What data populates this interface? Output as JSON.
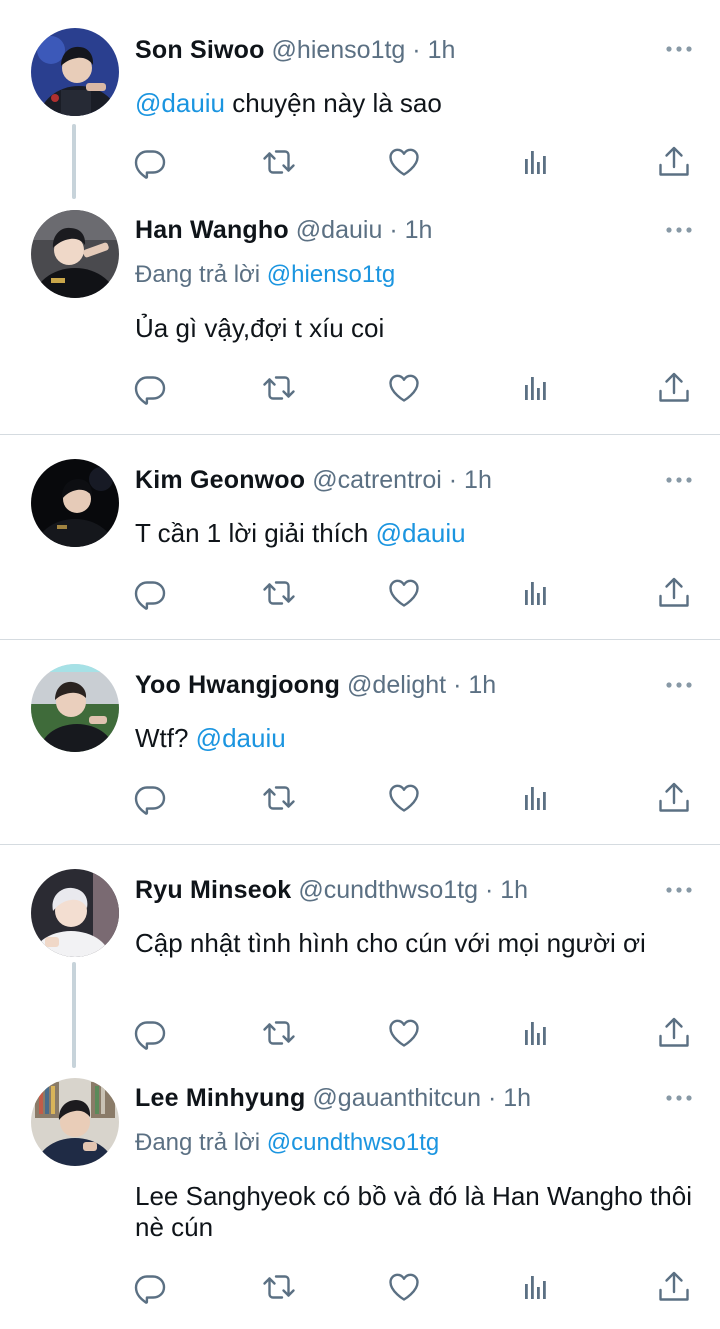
{
  "tweets": [
    {
      "name": "Son Siwoo",
      "handle": "@hienso1tg",
      "dot": "·",
      "time": "1h",
      "reply_prefix": "",
      "reply_to": "",
      "text_before": "",
      "mention": "@dauiu",
      "text_after": " chuyện này là sao"
    },
    {
      "name": "Han Wangho",
      "handle": "@dauiu",
      "dot": "·",
      "time": "1h",
      "reply_prefix": "Đang trả lời ",
      "reply_to": "@hienso1tg",
      "text_before": "Ủa gì vậy,đợi t xíu coi",
      "mention": "",
      "text_after": ""
    },
    {
      "name": "Kim Geonwoo",
      "handle": "@catrentroi",
      "dot": "·",
      "time": "1h",
      "reply_prefix": "",
      "reply_to": "",
      "text_before": "T cần 1 lời giải thích ",
      "mention": "@dauiu",
      "text_after": ""
    },
    {
      "name": "Yoo Hwangjoong",
      "handle": "@delight",
      "dot": "·",
      "time": "1h",
      "reply_prefix": "",
      "reply_to": "",
      "text_before": "Wtf? ",
      "mention": "@dauiu",
      "text_after": ""
    },
    {
      "name": "Ryu Minseok",
      "handle": "@cundthwso1tg",
      "dot": "·",
      "time": "1h",
      "reply_prefix": "",
      "reply_to": "",
      "text_before": "Cập nhật tình hình cho cún với mọi người ơi",
      "mention": "",
      "text_after": ""
    },
    {
      "name": "Lee Minhyung",
      "handle": "@gauanthitcun",
      "dot": "·",
      "time": "1h",
      "reply_prefix": "Đang trả lời ",
      "reply_to": "@cundthwso1tg",
      "text_before": "Lee Sanghyeok có bồ và đó là Han Wangho thôi nè cún",
      "mention": "",
      "text_after": ""
    }
  ],
  "icons": {
    "reply": "reply-icon",
    "retweet": "retweet-icon",
    "like": "heart-icon",
    "stats": "analytics-icon",
    "share": "share-icon",
    "more": "more-icon"
  },
  "colors": {
    "text": "#0f1419",
    "secondary": "#5b7083",
    "mention": "#1b95e0",
    "thread_line": "#c7d3da",
    "divider": "#d5dbe0"
  }
}
